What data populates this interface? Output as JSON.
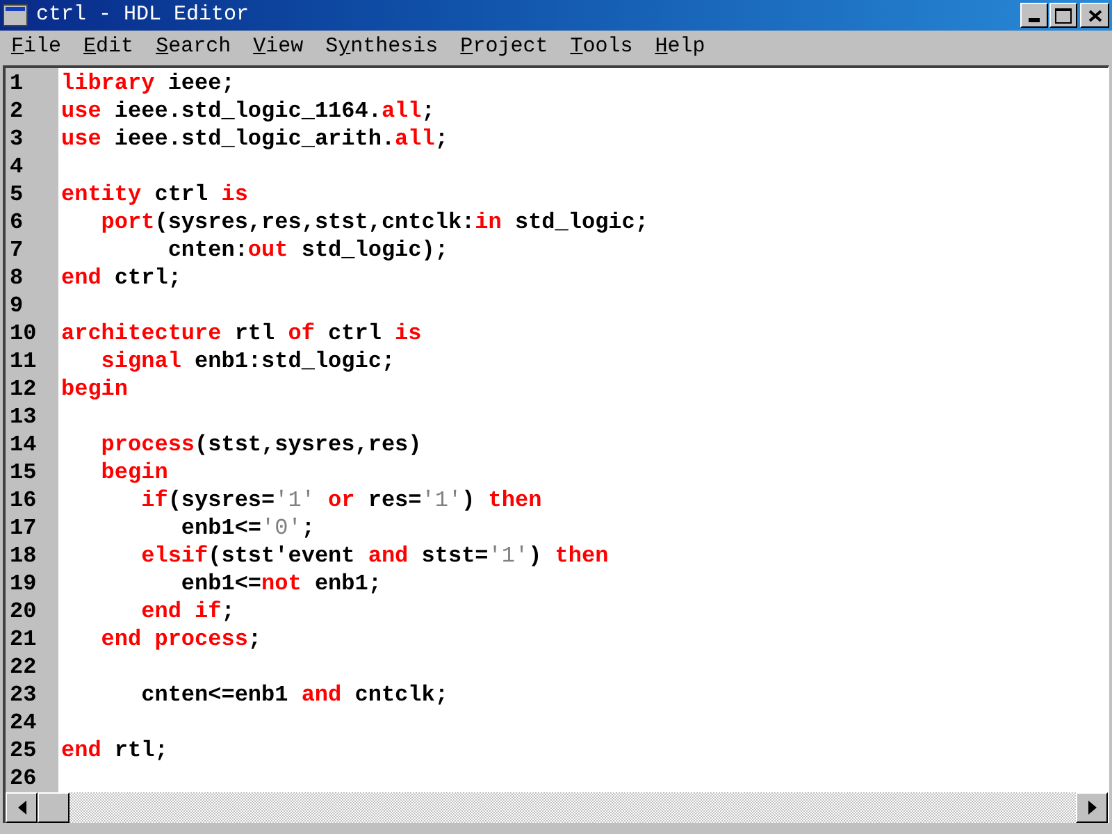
{
  "window": {
    "title": "ctrl - HDL Editor"
  },
  "menu": [
    {
      "key": "F",
      "rest": "ile"
    },
    {
      "key": "E",
      "rest": "dit"
    },
    {
      "key": "S",
      "rest": "earch"
    },
    {
      "key": "V",
      "rest": "iew"
    },
    {
      "lead": "S",
      "key": "y",
      "rest": "nthesis"
    },
    {
      "key": "P",
      "rest": "roject"
    },
    {
      "key": "T",
      "rest": "ools"
    },
    {
      "key": "H",
      "rest": "elp"
    }
  ],
  "lines": [
    {
      "number": "1",
      "tokens": [
        {
          "kind": "keyword",
          "text": "library"
        },
        {
          "kind": "plain",
          "text": " ieee;"
        }
      ]
    },
    {
      "number": "2",
      "tokens": [
        {
          "kind": "keyword",
          "text": "use"
        },
        {
          "kind": "plain",
          "text": " ieee.std_logic_1164."
        },
        {
          "kind": "keyword",
          "text": "all"
        },
        {
          "kind": "plain",
          "text": ";"
        }
      ]
    },
    {
      "number": "3",
      "tokens": [
        {
          "kind": "keyword",
          "text": "use"
        },
        {
          "kind": "plain",
          "text": " ieee.std_logic_arith."
        },
        {
          "kind": "keyword",
          "text": "all"
        },
        {
          "kind": "plain",
          "text": ";"
        }
      ]
    },
    {
      "number": "4"
    },
    {
      "number": "5",
      "tokens": [
        {
          "kind": "keyword",
          "text": "entity"
        },
        {
          "kind": "plain",
          "text": " ctrl "
        },
        {
          "kind": "keyword",
          "text": "is"
        }
      ]
    },
    {
      "number": "6",
      "tokens": [
        {
          "kind": "keyword",
          "text": "   port"
        },
        {
          "kind": "plain",
          "text": "(sysres,res,stst,cntclk:"
        },
        {
          "kind": "keyword",
          "text": "in"
        },
        {
          "kind": "plain",
          "text": " std_logic;"
        }
      ]
    },
    {
      "number": "7",
      "tokens": [
        {
          "kind": "plain",
          "text": "        cnten:"
        },
        {
          "kind": "keyword",
          "text": "out"
        },
        {
          "kind": "plain",
          "text": " std_logic);"
        }
      ]
    },
    {
      "number": "8",
      "tokens": [
        {
          "kind": "keyword",
          "text": "end"
        },
        {
          "kind": "plain",
          "text": " ctrl;"
        }
      ]
    },
    {
      "number": "9"
    },
    {
      "number": "10",
      "tokens": [
        {
          "kind": "keyword",
          "text": "architecture"
        },
        {
          "kind": "plain",
          "text": " rtl "
        },
        {
          "kind": "keyword",
          "text": "of"
        },
        {
          "kind": "plain",
          "text": " ctrl "
        },
        {
          "kind": "keyword",
          "text": "is"
        }
      ]
    },
    {
      "number": "11",
      "tokens": [
        {
          "kind": "keyword",
          "text": "   signal"
        },
        {
          "kind": "plain",
          "text": " enb1:std_logic;"
        }
      ]
    },
    {
      "number": "12",
      "tokens": [
        {
          "kind": "keyword",
          "text": "begin"
        }
      ]
    },
    {
      "number": "13"
    },
    {
      "number": "14",
      "tokens": [
        {
          "kind": "keyword",
          "text": "   process"
        },
        {
          "kind": "plain",
          "text": "(stst,sysres,res)"
        }
      ]
    },
    {
      "number": "15",
      "tokens": [
        {
          "kind": "keyword",
          "text": "   begin"
        }
      ]
    },
    {
      "number": "16",
      "tokens": [
        {
          "kind": "keyword",
          "text": "      if"
        },
        {
          "kind": "plain",
          "text": "(sysres="
        },
        {
          "kind": "literal",
          "text": "'1'"
        },
        {
          "kind": "keyword",
          "text": " or"
        },
        {
          "kind": "plain",
          "text": " res="
        },
        {
          "kind": "literal",
          "text": "'1'"
        },
        {
          "kind": "plain",
          "text": ") "
        },
        {
          "kind": "keyword",
          "text": "then"
        }
      ]
    },
    {
      "number": "17",
      "tokens": [
        {
          "kind": "plain",
          "text": "         enb1<="
        },
        {
          "kind": "literal",
          "text": "'0'"
        },
        {
          "kind": "plain",
          "text": ";"
        }
      ]
    },
    {
      "number": "18",
      "tokens": [
        {
          "kind": "keyword",
          "text": "      elsif"
        },
        {
          "kind": "plain",
          "text": "(stst'event "
        },
        {
          "kind": "keyword",
          "text": "and"
        },
        {
          "kind": "plain",
          "text": " stst="
        },
        {
          "kind": "literal",
          "text": "'1'"
        },
        {
          "kind": "plain",
          "text": ") "
        },
        {
          "kind": "keyword",
          "text": "then"
        }
      ]
    },
    {
      "number": "19",
      "tokens": [
        {
          "kind": "plain",
          "text": "         enb1<="
        },
        {
          "kind": "keyword",
          "text": "not"
        },
        {
          "kind": "plain",
          "text": " enb1;"
        }
      ]
    },
    {
      "number": "20",
      "tokens": [
        {
          "kind": "keyword",
          "text": "      end if"
        },
        {
          "kind": "plain",
          "text": ";"
        }
      ]
    },
    {
      "number": "21",
      "tokens": [
        {
          "kind": "keyword",
          "text": "   end process"
        },
        {
          "kind": "plain",
          "text": ";"
        }
      ]
    },
    {
      "number": "22"
    },
    {
      "number": "23",
      "tokens": [
        {
          "kind": "plain",
          "text": "      cnten<=enb1 "
        },
        {
          "kind": "keyword",
          "text": "and"
        },
        {
          "kind": "plain",
          "text": " cntclk;"
        }
      ]
    },
    {
      "number": "24"
    },
    {
      "number": "25",
      "tokens": [
        {
          "kind": "keyword",
          "text": "end"
        },
        {
          "kind": "plain",
          "text": " rtl;"
        }
      ]
    },
    {
      "number": "26"
    }
  ]
}
